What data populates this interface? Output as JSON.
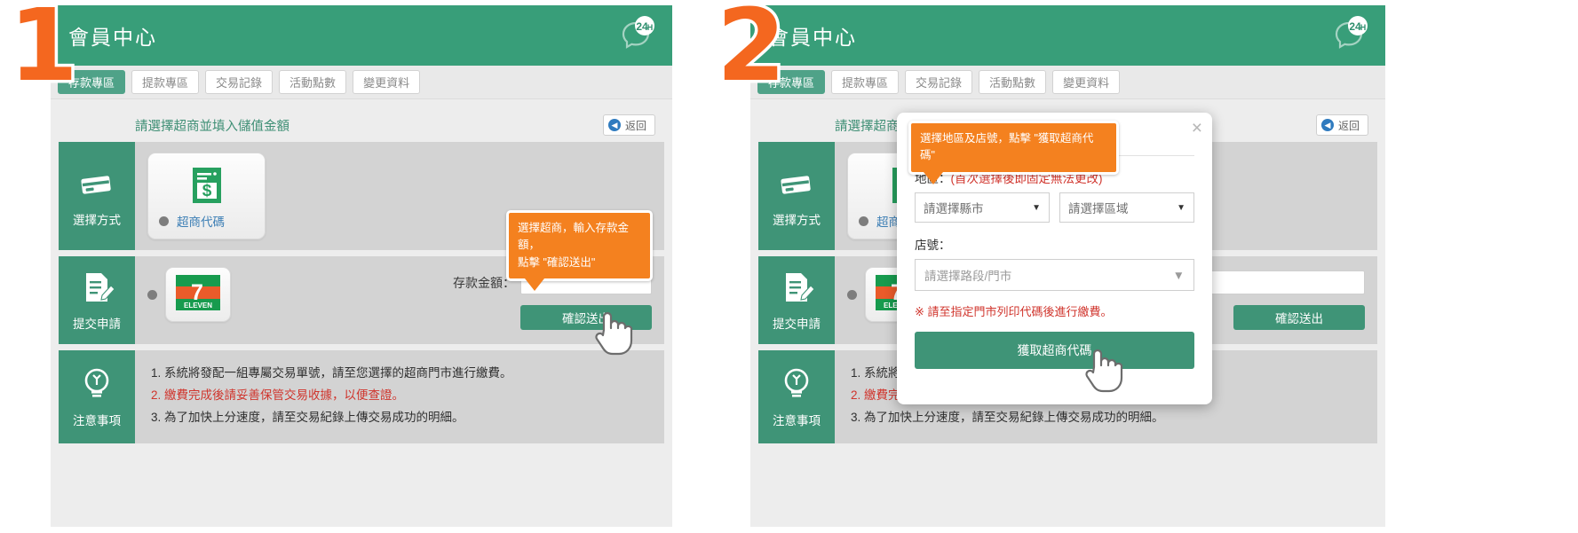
{
  "steps": {
    "one": "1",
    "two": "2"
  },
  "header": {
    "title": "會員中心",
    "badge_24h": "24",
    "badge_h": "H"
  },
  "tabs": [
    {
      "label": "存款專區",
      "active": true
    },
    {
      "label": "提款專區",
      "active": false
    },
    {
      "label": "交易記錄",
      "active": false
    },
    {
      "label": "活動點數",
      "active": false
    },
    {
      "label": "變更資料",
      "active": false
    }
  ],
  "card": {
    "title": "請選擇超商並填入儲值金額",
    "back_label": "返回",
    "back_icon": "chevron-left-icon"
  },
  "sections": {
    "method": {
      "label": "選擇方式",
      "icon": "credit-card-icon"
    },
    "submit": {
      "label": "提交申請",
      "icon": "document-pen-icon"
    },
    "notice": {
      "label": "注意事項",
      "icon": "lightbulb-icon"
    }
  },
  "method_option": {
    "label": "超商代碼",
    "icon": "receipt-dollar-icon",
    "selected": true
  },
  "store_option": {
    "icon": "seven-eleven-logo",
    "logo_text": "ELEVEN",
    "logo_number": "7",
    "selected": true
  },
  "amount": {
    "label": "存款金額：",
    "value": "",
    "placeholder": ""
  },
  "submit_button": {
    "label": "確認送出"
  },
  "notes": [
    {
      "text": "1. 系統將發配一組專屬交易單號，請至您選擇的超商門市進行繳費。",
      "warn": false
    },
    {
      "text": "2. 繳費完成後請妥善保管交易收據，以便查證。",
      "warn": true
    },
    {
      "text": "3. 為了加快上分速度，請至交易紀錄上傳交易成功的明細。",
      "warn": false
    }
  ],
  "tooltip_1": {
    "line1": "選擇超商，輸入存款金額，",
    "line2": "點擊 \"確認送出\""
  },
  "modal": {
    "tooltip": "選擇地區及店號，點擊 \"獲取超商代碼\"",
    "close_icon": "close-icon",
    "region_label_main": "地區：",
    "region_label_note": "(首次選擇後即固定無法更改)",
    "select_city": "請選擇縣市",
    "select_area": "請選擇區域",
    "store_label": "店號：",
    "select_store": "請選擇路段/門市",
    "warning": "※ 請至指定門市列印代碼後進行繳費。",
    "button": "獲取超商代碼",
    "caret_icon": "chevron-down-icon"
  },
  "colors": {
    "brand_green": "#3f9477",
    "header_green": "#389e79",
    "orange": "#f4811f",
    "step_orange": "#f4671f",
    "red": "#d0342c",
    "link_blue": "#3d7fb5",
    "panel_grey": "#d3d3d3"
  }
}
